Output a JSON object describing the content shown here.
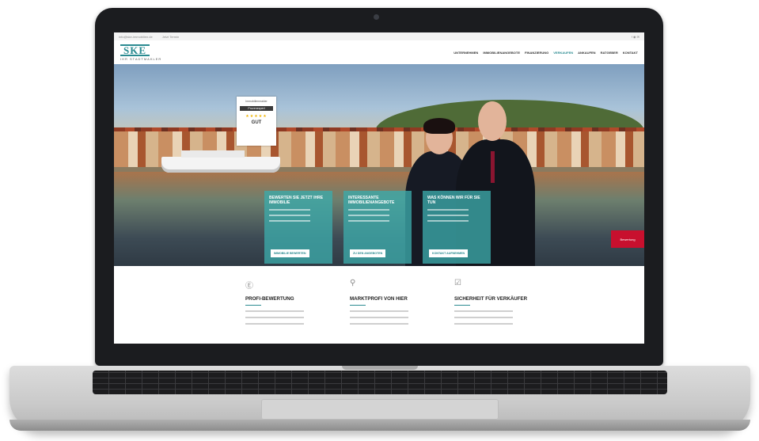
{
  "site": {
    "logo_mark": "SKE",
    "logo_sub": "IHR STADTMAKLER",
    "nav": [
      "UNTERNEHMEN",
      "IMMOBILIENANGEBOTE",
      "FINANZIERUNG",
      "VERKAUFEN",
      "ANKAUFEN",
      "RATGEBER",
      "KONTAKT"
    ],
    "topbar_left": [
      "info@ske-immobilien.de",
      "Jetzt Termin"
    ],
    "badge": {
      "title": "Immobilienmakler",
      "brand": "Provenexpert",
      "rating": "GUT"
    },
    "cards": [
      {
        "title": "BEWERTEN SIE JETZT IHRE IMMOBILIE",
        "button": "IMMOBILIE BEWERTEN"
      },
      {
        "title": "INTERESSANTE IMMOBILIENANGEBOTE",
        "button": "ZU DEN ANGEBOTEN"
      },
      {
        "title": "WAS KÖNNEN WIR FÜR SIE TUN",
        "button": "KONTAKT AUFNEHMEN"
      }
    ],
    "side_tab": "Bewertung",
    "features": [
      {
        "icon": "euro-circle-icon",
        "title": "PROFI-BEWERTUNG"
      },
      {
        "icon": "location-pin-icon",
        "title": "MARKTPROFI VON HIER"
      },
      {
        "icon": "checkbox-icon",
        "title": "SICHERHEIT FÜR VERKÄUFER"
      }
    ]
  }
}
